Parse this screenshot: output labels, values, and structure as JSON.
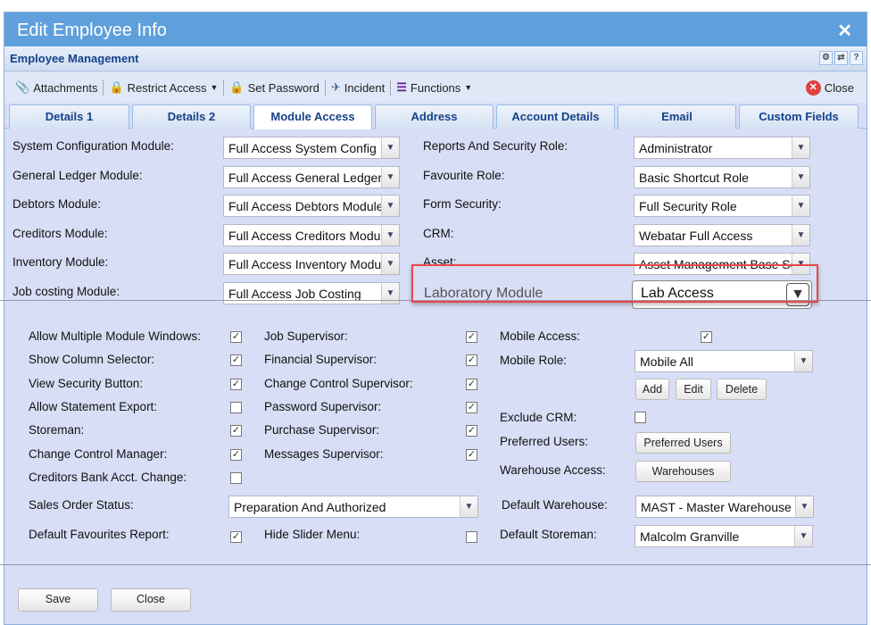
{
  "window": {
    "title": "Edit Employee Info",
    "close": "✕"
  },
  "header": {
    "title": "Employee Management",
    "tools": [
      "⚙",
      "⇄",
      "?"
    ]
  },
  "toolbar": {
    "attachments": "Attachments",
    "restrict_access": "Restrict Access",
    "set_password": "Set Password",
    "incident": "Incident",
    "functions": "Functions",
    "close": "Close"
  },
  "tabs": [
    "Details 1",
    "Details 2",
    "Module Access",
    "Address",
    "Account Details",
    "Email",
    "Custom Fields"
  ],
  "active_tab": "Module Access",
  "modules_left": [
    {
      "label": "System Configuration Module:",
      "value": "Full Access System Config"
    },
    {
      "label": "General Ledger Module:",
      "value": "Full Access General Ledger"
    },
    {
      "label": "Debtors Module:",
      "value": "Full Access Debtors Module"
    },
    {
      "label": "Creditors Module:",
      "value": "Full Access Creditors Module"
    },
    {
      "label": "Inventory Module:",
      "value": "Full Access Inventory Module"
    },
    {
      "label": "Job costing Module:",
      "value": "Full Access Job Costing"
    }
  ],
  "modules_right": [
    {
      "label": "Reports And Security Role:",
      "value": "Administrator"
    },
    {
      "label": "Favourite Role:",
      "value": "Basic Shortcut Role"
    },
    {
      "label": "Form Security:",
      "value": "Full Security Role"
    },
    {
      "label": "CRM:",
      "value": "Webatar Full Access"
    },
    {
      "label": "Asset:",
      "value": "Asset Management Base Security"
    }
  ],
  "laboratory": {
    "label": "Laboratory Module",
    "value": "Lab Access"
  },
  "checks_col1": [
    {
      "label": "Allow Multiple Module Windows:",
      "checked": true
    },
    {
      "label": "Show Column Selector:",
      "checked": true
    },
    {
      "label": "View Security Button:",
      "checked": true
    },
    {
      "label": "Allow Statement Export:",
      "checked": false
    },
    {
      "label": "Storeman:",
      "checked": true
    },
    {
      "label": "Change Control Manager:",
      "checked": true
    },
    {
      "label": "Creditors Bank Acct. Change:",
      "checked": false
    }
  ],
  "checks_col2": [
    {
      "label": "Job Supervisor:",
      "checked": true
    },
    {
      "label": "Financial Supervisor:",
      "checked": true
    },
    {
      "label": "Change Control Supervisor:",
      "checked": true
    },
    {
      "label": "Password Supervisor:",
      "checked": true
    },
    {
      "label": "Purchase Supervisor:",
      "checked": true
    },
    {
      "label": "Messages Supervisor:",
      "checked": true
    }
  ],
  "sales_order_status": {
    "label": "Sales Order Status:",
    "value": "Preparation And Authorized"
  },
  "default_favourites": {
    "label": "Default Favourites Report:",
    "checked": true
  },
  "hide_slider": {
    "label": "Hide Slider Menu:",
    "checked": false
  },
  "mobile_access": {
    "label": "Mobile Access:",
    "checked": true
  },
  "mobile_role": {
    "label": "Mobile Role:",
    "value": "Mobile All",
    "add": "Add",
    "edit": "Edit",
    "delete": "Delete"
  },
  "exclude_crm": {
    "label": "Exclude CRM:",
    "checked": false
  },
  "preferred_users": {
    "label": "Preferred Users:",
    "button": "Preferred Users"
  },
  "warehouse_access": {
    "label": "Warehouse Access:",
    "button": "Warehouses"
  },
  "default_warehouse": {
    "label": "Default Warehouse:",
    "value": "MAST - Master Warehouse"
  },
  "default_storeman": {
    "label": "Default Storeman:",
    "value": "Malcolm Granville"
  },
  "footer": {
    "save": "Save",
    "close": "Close"
  }
}
